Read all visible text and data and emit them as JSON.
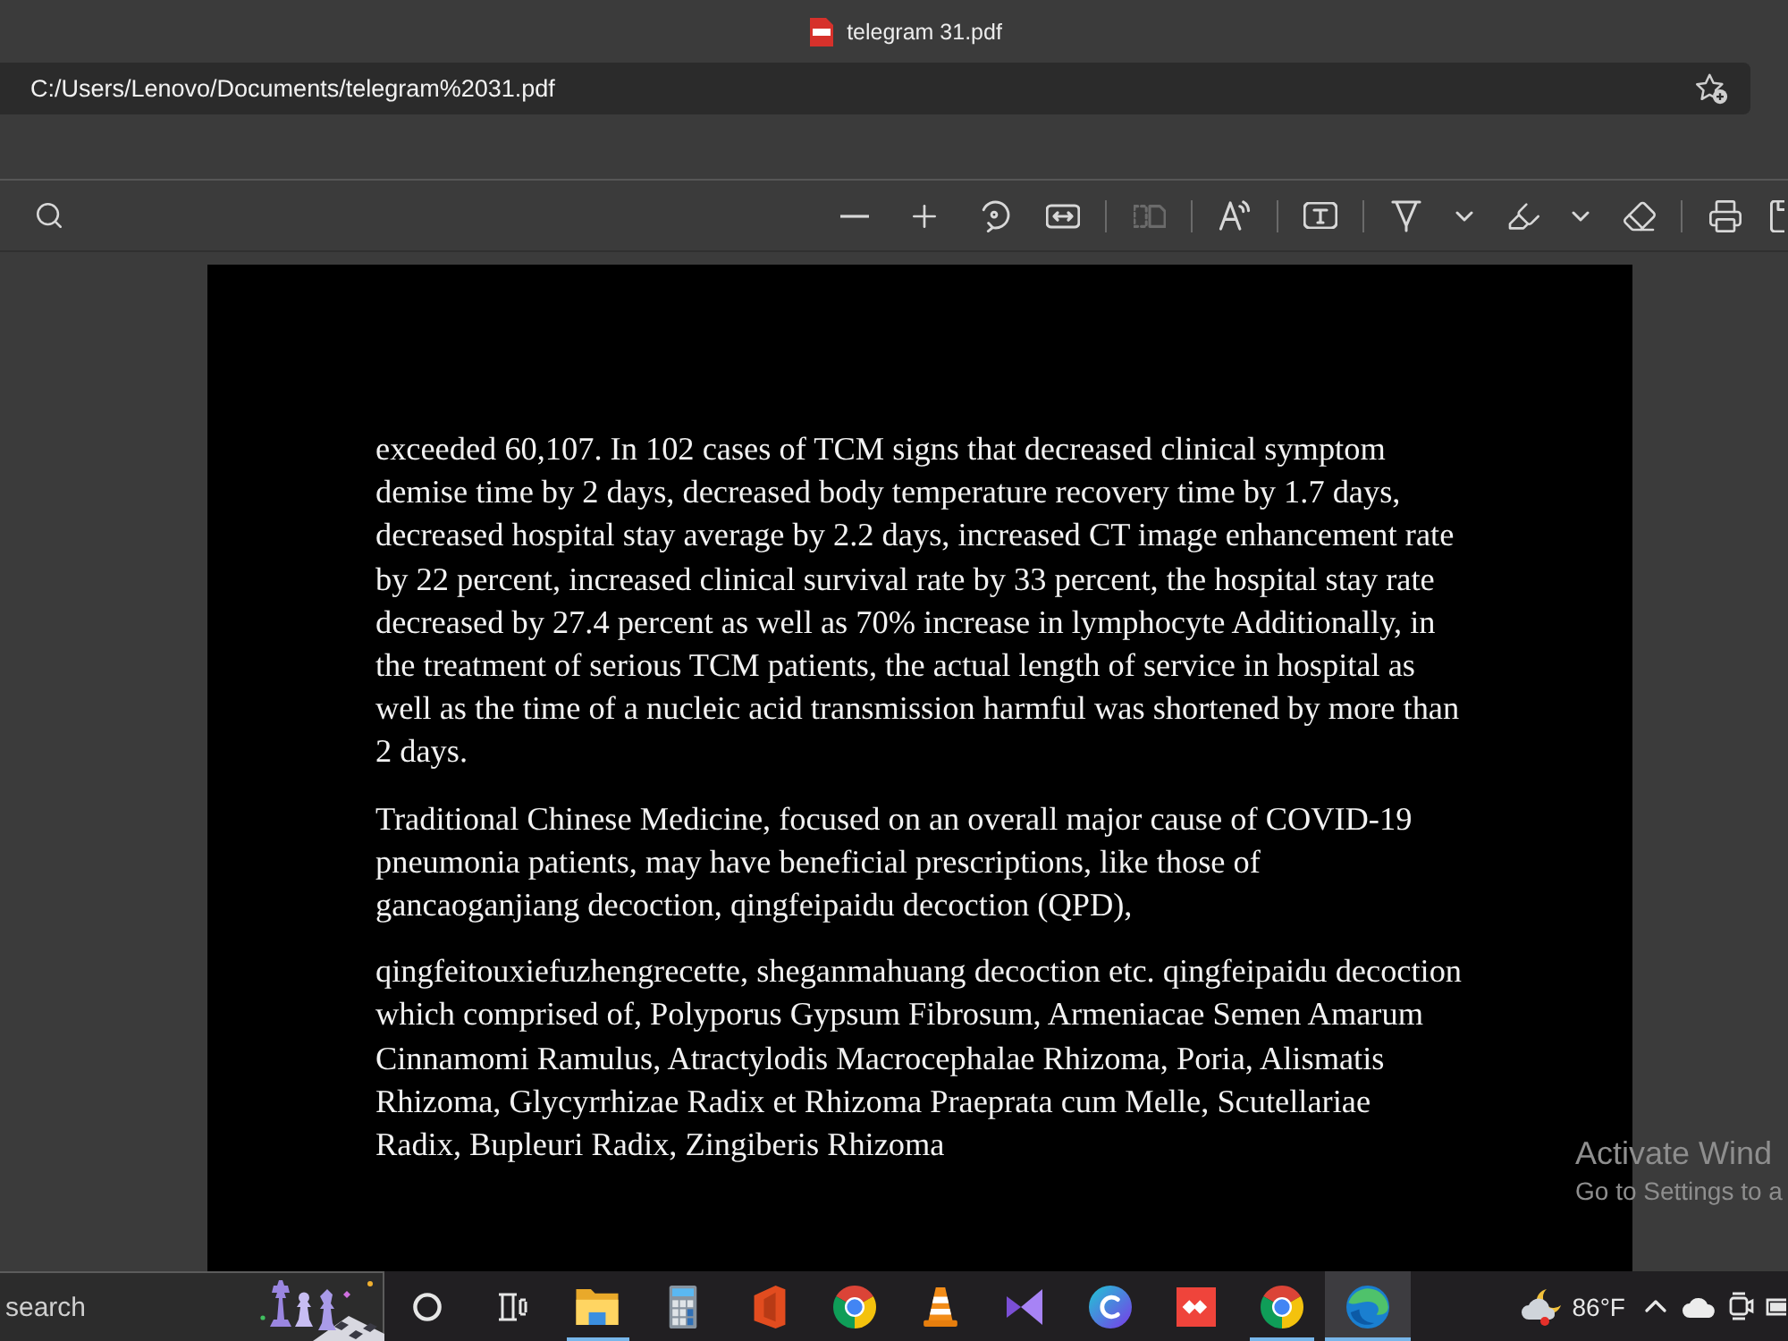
{
  "window": {
    "title": "telegram 31.pdf"
  },
  "address_bar": {
    "url": "C:/Users/Lenovo/Documents/telegram%2031.pdf"
  },
  "toolbar": {
    "search": {
      "disabled": false
    },
    "groups": [
      [
        {
          "kind": "zoom_out",
          "disabled": false
        },
        {
          "kind": "zoom_in",
          "disabled": false
        },
        {
          "kind": "rotate",
          "disabled": false
        },
        {
          "kind": "fit_width",
          "disabled": false
        }
      ],
      [
        {
          "kind": "page_view",
          "disabled": true
        }
      ],
      [
        {
          "kind": "read_aloud",
          "disabled": false
        }
      ],
      [
        {
          "kind": "add_text",
          "disabled": false
        }
      ],
      [
        {
          "kind": "draw",
          "disabled": false
        },
        {
          "kind": "dropdown",
          "disabled": false
        },
        {
          "kind": "highlight",
          "disabled": false
        },
        {
          "kind": "dropdown",
          "disabled": false
        },
        {
          "kind": "erase",
          "disabled": false
        }
      ],
      [
        {
          "kind": "print",
          "disabled": false
        },
        {
          "kind": "save",
          "disabled": false
        }
      ]
    ]
  },
  "document": {
    "paragraphs": [
      "exceeded 60,107. In 102 cases of TCM signs that decreased clinical symptom demise time by 2 days, decreased body temperature recovery time by 1.7 days, decreased hospital stay average by 2.2 days, increased CT image enhancement rate by 22 percent, increased clinical survival rate by 33 percent, the hospital stay rate decreased by 27.4 percent as well as 70% increase in lymphocyte Additionally, in the treatment of serious TCM patients, the actual length of service in hospital as well as the time of a nucleic acid transmission harmful was shortened by more than 2 days.",
      "Traditional Chinese Medicine, focused on an overall major cause of COVID-19 pneumonia patients, may have beneficial prescriptions, like those of gancaoganjiang decoction, qingfeipaidu decoction (QPD),",
      "qingfeitouxiefuzhengrecette, sheganmahuang decoction etc. qingfeipaidu decoction which comprised of, Polyporus Gypsum Fibrosum, Armeniacae Semen Amarum Cinnamomi Ramulus, Atractylodis Macrocephalae Rhizoma, Poria, Alismatis Rhizoma, Glycyrrhizae Radix et Rhizoma Praeprata cum Melle, Scutellariae Radix, Bupleuri Radix, Zingiberis Rhizoma"
    ]
  },
  "activation_notice": {
    "title": "Activate Wind",
    "subtitle": "Go to Settings to a"
  },
  "taskbar": {
    "search": {
      "placeholder": "search"
    },
    "apps": [
      {
        "kind": "file_explorer",
        "running": true,
        "active": false
      },
      {
        "kind": "calculator",
        "running": false,
        "active": false
      },
      {
        "kind": "office",
        "running": false,
        "active": false
      },
      {
        "kind": "chrome",
        "running": false,
        "active": false
      },
      {
        "kind": "vlc",
        "running": false,
        "active": false
      },
      {
        "kind": "visual_studio",
        "running": false,
        "active": false
      },
      {
        "kind": "canva",
        "running": false,
        "active": false
      },
      {
        "kind": "anydesk",
        "running": false,
        "active": false
      },
      {
        "kind": "chrome",
        "running": true,
        "active": false
      },
      {
        "kind": "edge",
        "running": true,
        "active": true
      }
    ],
    "weather": {
      "temperature": "86°F"
    }
  }
}
